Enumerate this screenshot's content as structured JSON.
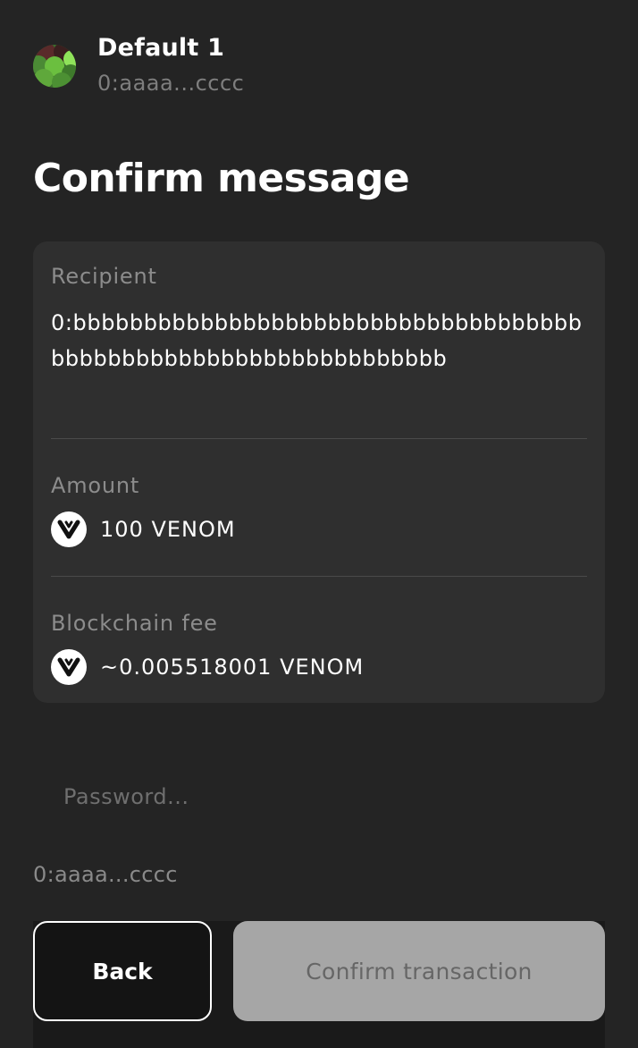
{
  "account": {
    "name": "Default 1",
    "address": "0:aaaa...cccc"
  },
  "title": "Confirm message",
  "details": {
    "recipient_label": "Recipient",
    "recipient_value": "0:bbbbbbbbbbbbbbbbbbbbbbbbbbbbbbbbbbbbbbbbbbbbbbbbbbbbbbbbbbbbbbbb",
    "amount_label": "Amount",
    "amount_value": "100 VENOM",
    "fee_label": "Blockchain fee",
    "fee_value": "~0.005518001 VENOM",
    "token_icon": "venom-icon"
  },
  "password": {
    "placeholder": "Password...",
    "value": ""
  },
  "selected_key": "0:aaaa...cccc",
  "buttons": {
    "back": "Back",
    "confirm": "Confirm transaction"
  },
  "colors": {
    "background": "#242424",
    "card": "#2f2f2f",
    "confirm_disabled": "#a6a6a6"
  }
}
